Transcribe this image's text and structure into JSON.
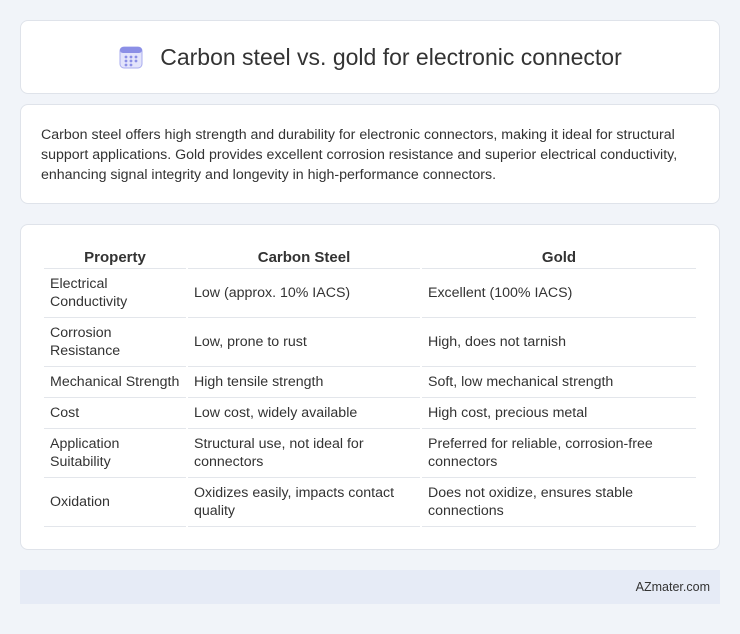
{
  "header": {
    "title": "Carbon steel vs. gold for electronic connector",
    "icon": "calendar-icon"
  },
  "summary": {
    "text": "Carbon steel offers high strength and durability for electronic connectors, making it ideal for structural support applications. Gold provides excellent corrosion resistance and superior electrical conductivity, enhancing signal integrity and longevity in high-performance connectors."
  },
  "table": {
    "headers": [
      "Property",
      "Carbon Steel",
      "Gold"
    ],
    "rows": [
      [
        "Electrical Conductivity",
        "Low (approx. 10% IACS)",
        "Excellent (100% IACS)"
      ],
      [
        "Corrosion Resistance",
        "Low, prone to rust",
        "High, does not tarnish"
      ],
      [
        "Mechanical Strength",
        "High tensile strength",
        "Soft, low mechanical strength"
      ],
      [
        "Cost",
        "Low cost, widely available",
        "High cost, precious metal"
      ],
      [
        "Application Suitability",
        "Structural use, not ideal for connectors",
        "Preferred for reliable, corrosion-free connectors"
      ],
      [
        "Oxidation",
        "Oxidizes easily, impacts contact quality",
        "Does not oxidize, ensures stable connections"
      ]
    ]
  },
  "footer": {
    "brand": "AZmater.com"
  },
  "colors": {
    "background": "#f1f4f9",
    "footer_bg": "#e6ebf6",
    "icon_accent": "#7b7fe0"
  }
}
